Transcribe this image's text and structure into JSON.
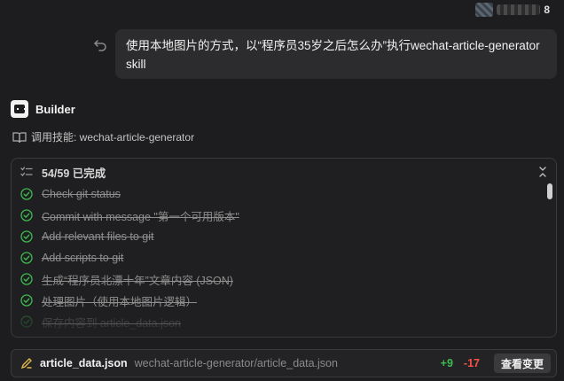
{
  "header": {
    "user_badge_number": "8"
  },
  "user_message": {
    "text": "使用本地图片的方式，以“程序员35岁之后怎么办”执行wechat-article-generator skill"
  },
  "agent": {
    "name": "Builder",
    "skill_invocation": "调用技能: wechat-article-generator"
  },
  "tasks": {
    "progress_label": "54/59 已完成",
    "completed": 54,
    "total": 59,
    "items": [
      {
        "label": "Check git status"
      },
      {
        "label": "Commit with message \"第一个可用版本\""
      },
      {
        "label": "Add relevant files to git"
      },
      {
        "label": "Add scripts to git"
      },
      {
        "label": "生成“程序员北漂十年”文章内容 (JSON)"
      },
      {
        "label": "处理图片（使用本地图片逻辑）"
      },
      {
        "label": "保存内容到 article_data.json"
      }
    ]
  },
  "file_change": {
    "file_name": "article_data.json",
    "file_path": "wechat-article-generator/article_data.json",
    "additions": "+9",
    "deletions": "-17",
    "view_button_label": "查看变更"
  },
  "colors": {
    "success": "#3fb950",
    "danger": "#f85149",
    "background": "#1d1d1f"
  }
}
